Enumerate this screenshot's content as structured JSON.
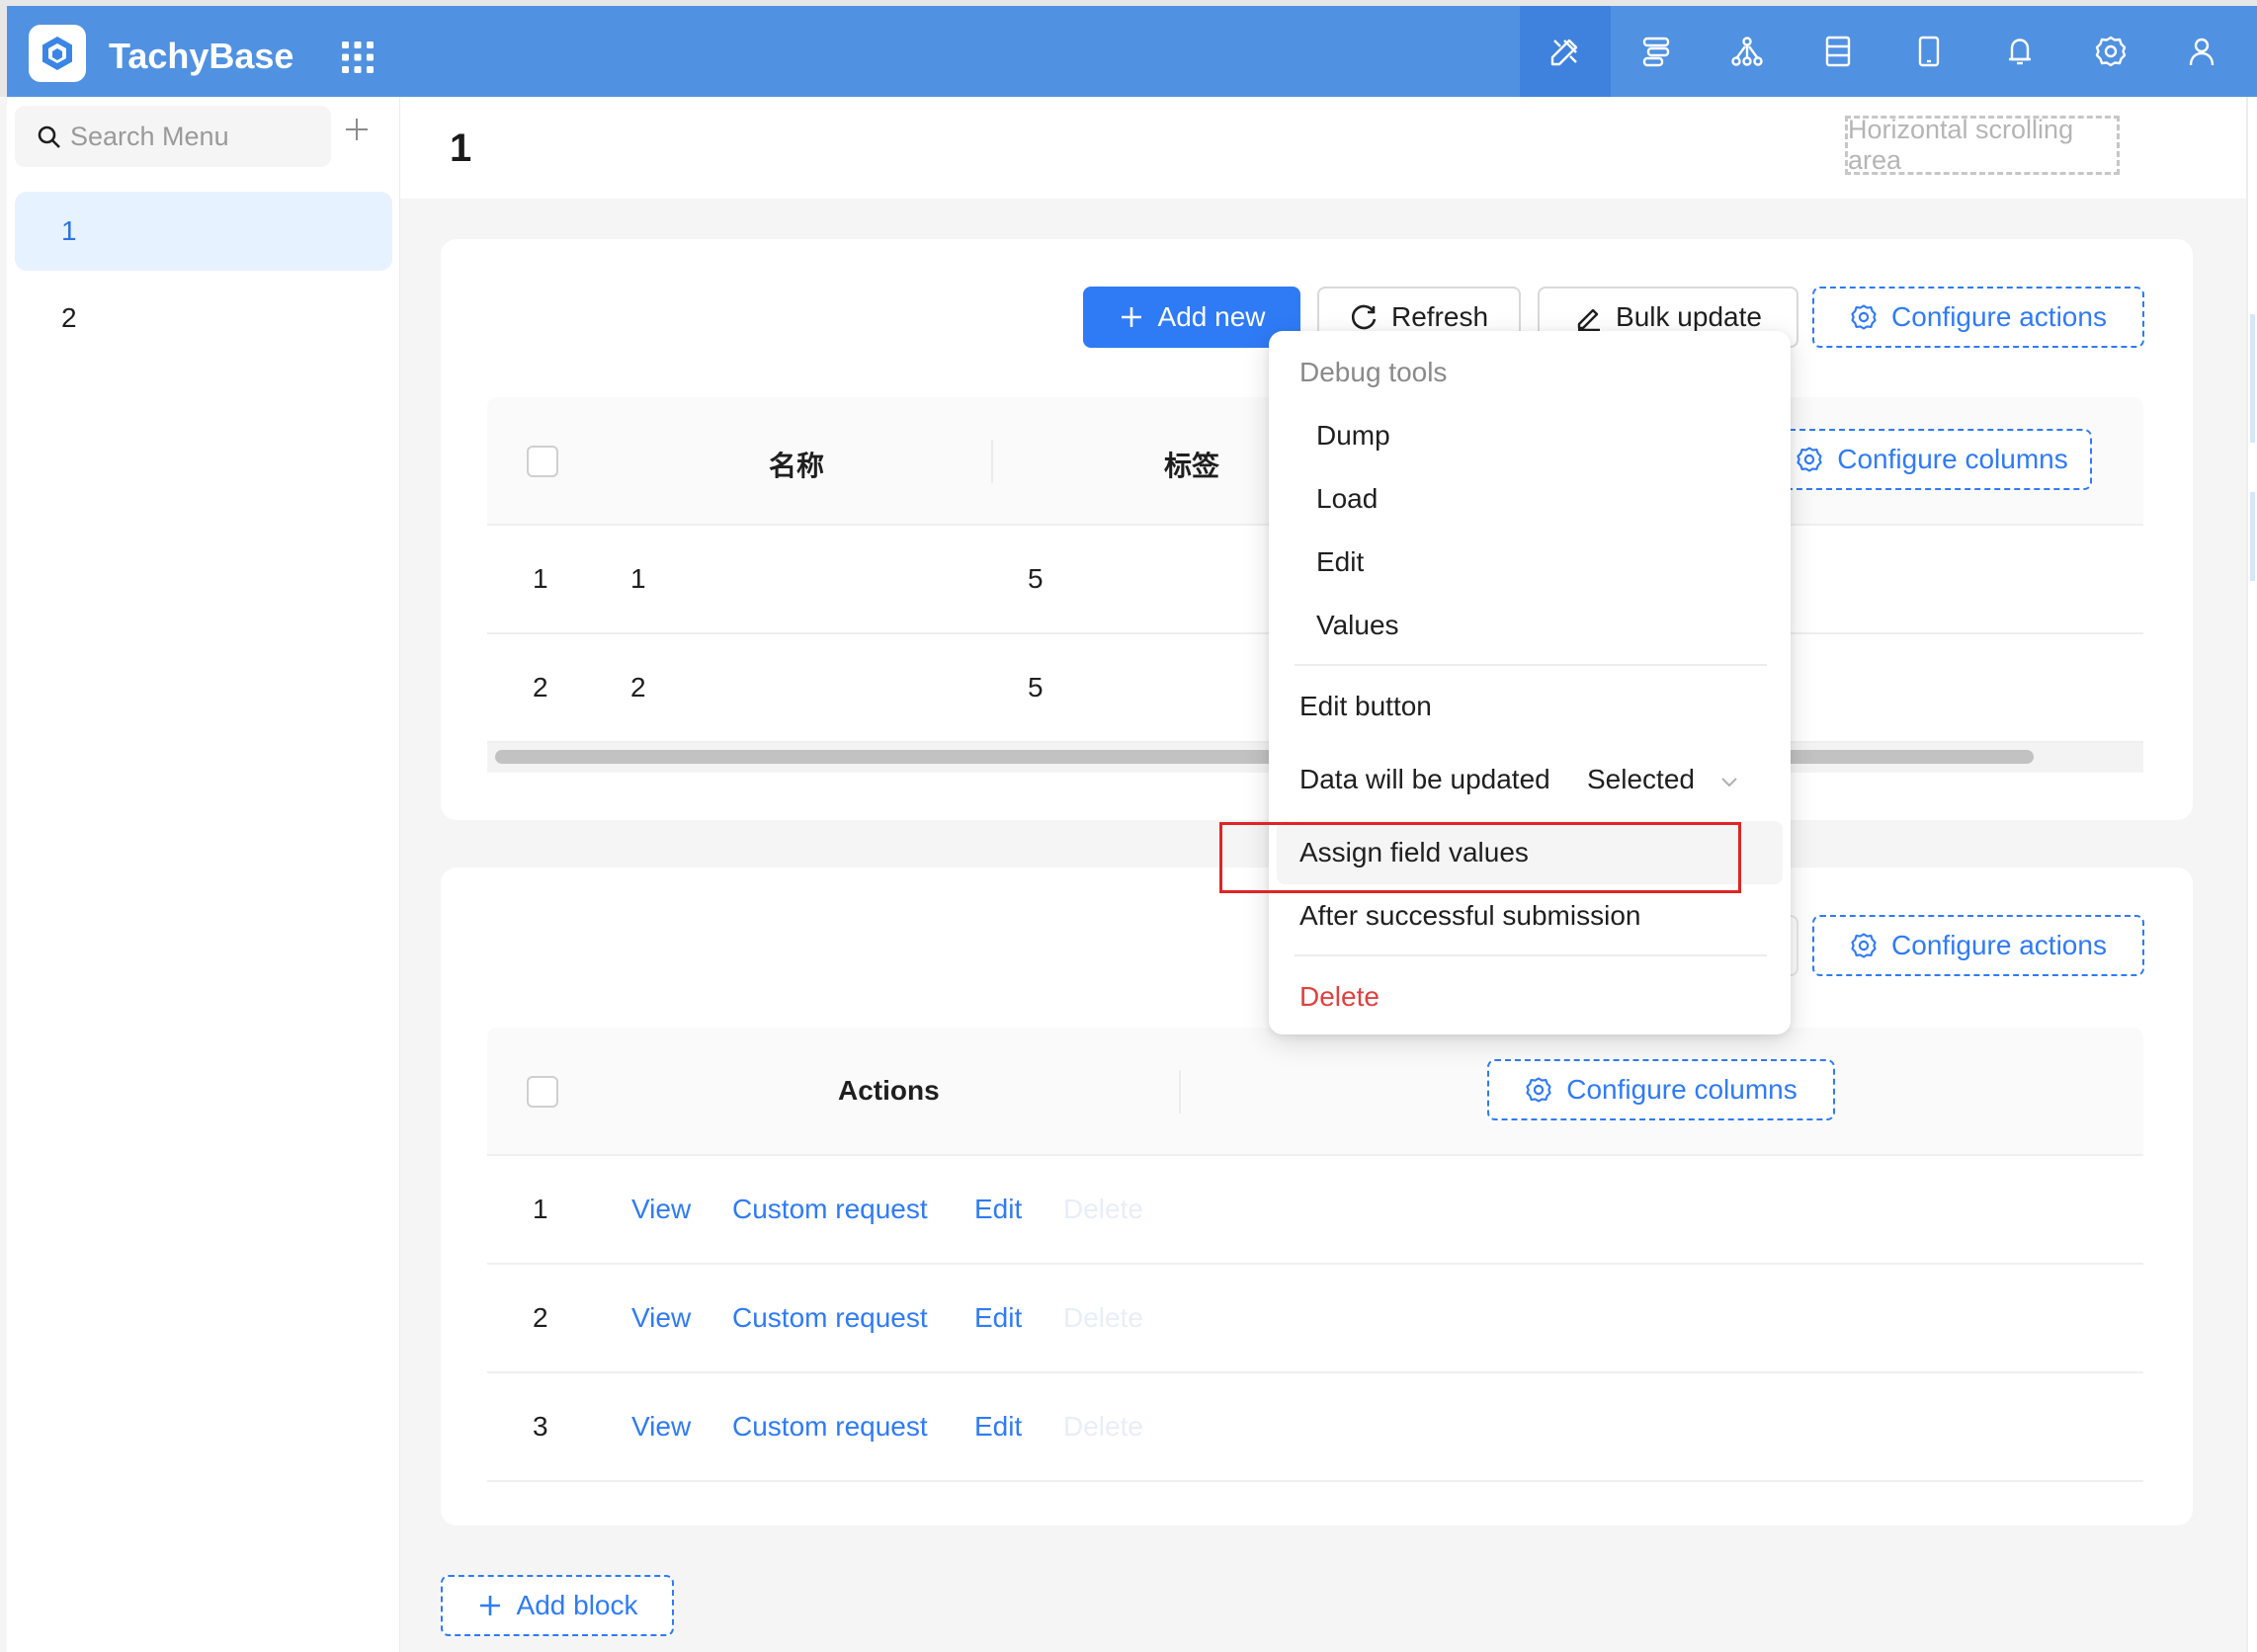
{
  "app": {
    "title": "TachyBase"
  },
  "colors": {
    "header": "#5091e1",
    "accent": "#2f7bf6",
    "danger": "#e0413f",
    "highlight_box": "#e02424"
  },
  "topbar": {
    "icons": [
      "ui-editor-icon",
      "workflow-icon",
      "relationships-icon",
      "collections-icon",
      "mobile-icon",
      "bell-icon",
      "gear-icon",
      "user-icon"
    ]
  },
  "sidebar": {
    "search_placeholder": "Search Menu",
    "items": [
      {
        "label": "1",
        "active": true
      },
      {
        "label": "2",
        "active": false
      }
    ]
  },
  "page": {
    "title": "1",
    "horizontal_scroll_label": "Horizontal scrolling area"
  },
  "block1": {
    "actions": {
      "add_new": "Add new",
      "refresh": "Refresh",
      "bulk_update": "Bulk update",
      "configure_actions": "Configure actions"
    },
    "columns": {
      "name": "名称",
      "tag": "标签",
      "configure_columns": "Configure columns"
    },
    "rows": [
      {
        "index": "1",
        "name": "1",
        "tag": "5"
      },
      {
        "index": "2",
        "name": "2",
        "tag": "5"
      }
    ]
  },
  "dropdown": {
    "group_label": "Debug tools",
    "debug_items": [
      "Dump",
      "Load",
      "Edit",
      "Values"
    ],
    "edit_button": "Edit button",
    "data_updated_label": "Data will be updated",
    "data_updated_value": "Selected",
    "assign_field_values": "Assign field values",
    "after_submission": "After successful submission",
    "delete": "Delete"
  },
  "block2": {
    "configure_actions": "Configure actions",
    "columns": {
      "actions": "Actions",
      "configure_columns": "Configure columns"
    },
    "row_indices": [
      "1",
      "2",
      "3"
    ],
    "row_actions": {
      "view": "View",
      "custom_request": "Custom request",
      "edit": "Edit",
      "delete": "Delete"
    }
  },
  "footer": {
    "add_block": "Add block"
  }
}
